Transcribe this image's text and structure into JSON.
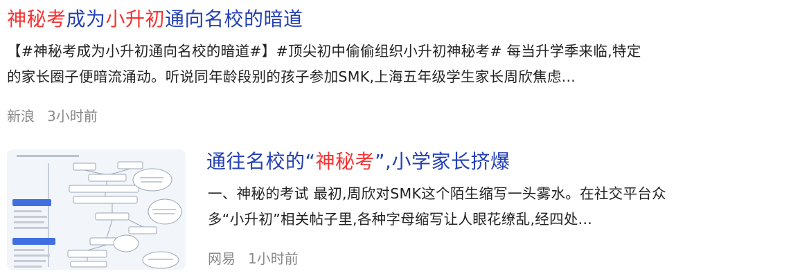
{
  "results": [
    {
      "title": {
        "part1": "神秘考",
        "part2": "成为",
        "part3": "小升初",
        "part4": "通向名校的暗道"
      },
      "snippet": {
        "line1": "【#神秘考成为小升初通向名校的暗道#】#顶尖初中偷偷组织小升初神秘考# 每当升学季来临,特定",
        "line2": "的家长圈子便暗流涌动。听说同年龄段别的孩子参加SMK,上海五年级学生家长周欣焦虑..."
      },
      "source": "新浪",
      "time": "3小时前"
    },
    {
      "title": {
        "part1": "通往名校的“",
        "part2": "神秘考",
        "part3": "”,小学家长挤爆"
      },
      "snippet": {
        "line1": "一、神秘的考试 最初,周欣对SMK这个陌生缩写一头雾水。在社交平台众",
        "line2": "多“小升初”相关帖子里,各种字母缩写让人眼花缭乱,经四处..."
      },
      "source": "网易",
      "time": "1小时前"
    }
  ],
  "colors": {
    "link": "#2440b3",
    "highlight": "#f73131",
    "text": "#222222",
    "meta": "#8a8a8a",
    "thumb_accent": "#3f6fe0"
  }
}
